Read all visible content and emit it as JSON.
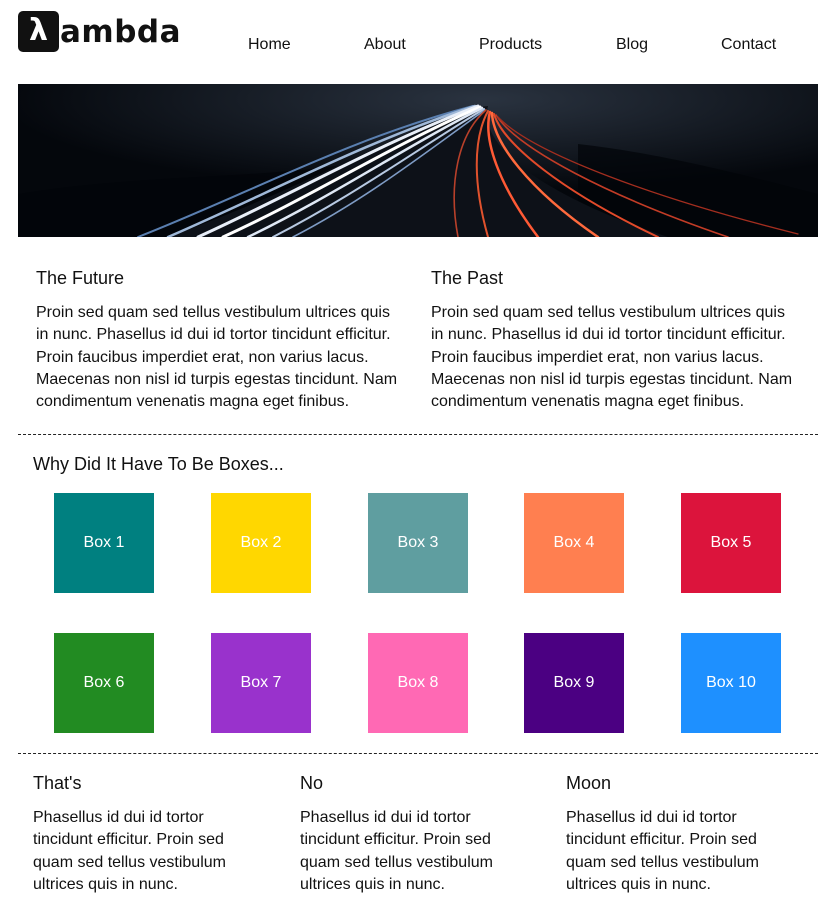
{
  "header": {
    "logo_mark": "λ",
    "logo_text": "ambda",
    "nav": [
      "Home",
      "About",
      "Products",
      "Blog",
      "Contact"
    ]
  },
  "hero": {
    "image": "night-highway-light-trails"
  },
  "top_section": {
    "columns": [
      {
        "title": "The Future",
        "body": "Proin sed quam sed tellus vestibulum ultrices quis in nunc. Phasellus id dui id tortor tincidunt efficitur. Proin faucibus imperdiet erat, non varius lacus. Maecenas non nisl id turpis egestas tincidunt. Nam condimentum venenatis magna eget finibus."
      },
      {
        "title": "The Past",
        "body": "Proin sed quam sed tellus vestibulum ultrices quis in nunc. Phasellus id dui id tortor tincidunt efficitur. Proin faucibus imperdiet erat, non varius lacus. Maecenas non nisl id turpis egestas tincidunt. Nam condimentum venenatis magna eget finibus."
      }
    ]
  },
  "boxes_section": {
    "title": "Why Did It Have To Be Boxes...",
    "boxes": [
      {
        "label": "Box 1",
        "color": "#008080"
      },
      {
        "label": "Box 2",
        "color": "#FFD700"
      },
      {
        "label": "Box 3",
        "color": "#5F9EA0"
      },
      {
        "label": "Box 4",
        "color": "#FF7F50"
      },
      {
        "label": "Box 5",
        "color": "#DC143C"
      },
      {
        "label": "Box 6",
        "color": "#228B22"
      },
      {
        "label": "Box 7",
        "color": "#9932CC"
      },
      {
        "label": "Box 8",
        "color": "#FF69B4"
      },
      {
        "label": "Box 9",
        "color": "#4B0082"
      },
      {
        "label": "Box 10",
        "color": "#1E90FF"
      }
    ]
  },
  "bottom_section": {
    "columns": [
      {
        "title": "That's",
        "body": "Phasellus id dui id tortor tincidunt efficitur. Proin sed quam sed tellus vestibulum ultrices quis in nunc."
      },
      {
        "title": "No",
        "body": "Phasellus id dui id tortor tincidunt efficitur. Proin sed quam sed tellus vestibulum ultrices quis in nunc."
      },
      {
        "title": "Moon",
        "body": "Phasellus id dui id tortor tincidunt efficitur. Proin sed quam sed tellus vestibulum ultrices quis in nunc."
      }
    ]
  }
}
